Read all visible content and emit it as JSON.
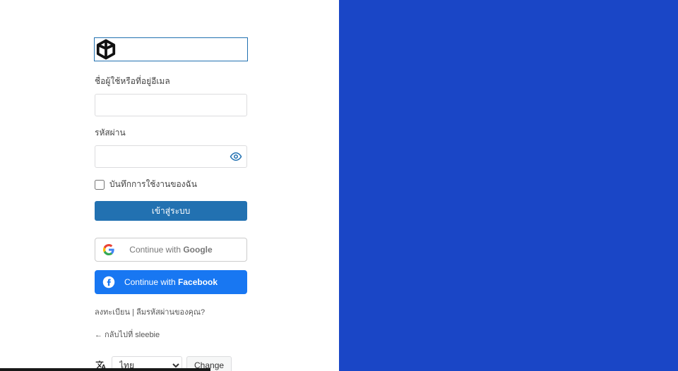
{
  "colors": {
    "brand_blue": "#1a46c6",
    "wp_blue": "#2271b1",
    "fb_blue": "#1877f2"
  },
  "form": {
    "username_label": "ชื่อผู้ใช้หรือที่อยู่อีเมล",
    "password_label": "รหัสผ่าน",
    "remember_label": "บันทึกการใช้งานของฉัน",
    "submit_label": "เข้าสู่ระบบ"
  },
  "social": {
    "google_prefix": "Continue with ",
    "google_bold": "Google",
    "facebook_prefix": "Continue with ",
    "facebook_bold": "Facebook"
  },
  "links": {
    "register": "ลงทะเบียน",
    "sep": " | ",
    "forgot": "ลืมรหัสผ่านของคุณ?",
    "back_arrow": "←",
    "back_text": " กลับไปที่ sleebie"
  },
  "lang": {
    "selected": "ไทย",
    "change": "Change"
  },
  "icons": {
    "logo": "brand-logo-icon",
    "eye": "show-password-icon",
    "google": "google-icon",
    "facebook": "facebook-icon",
    "translate": "translate-icon"
  }
}
